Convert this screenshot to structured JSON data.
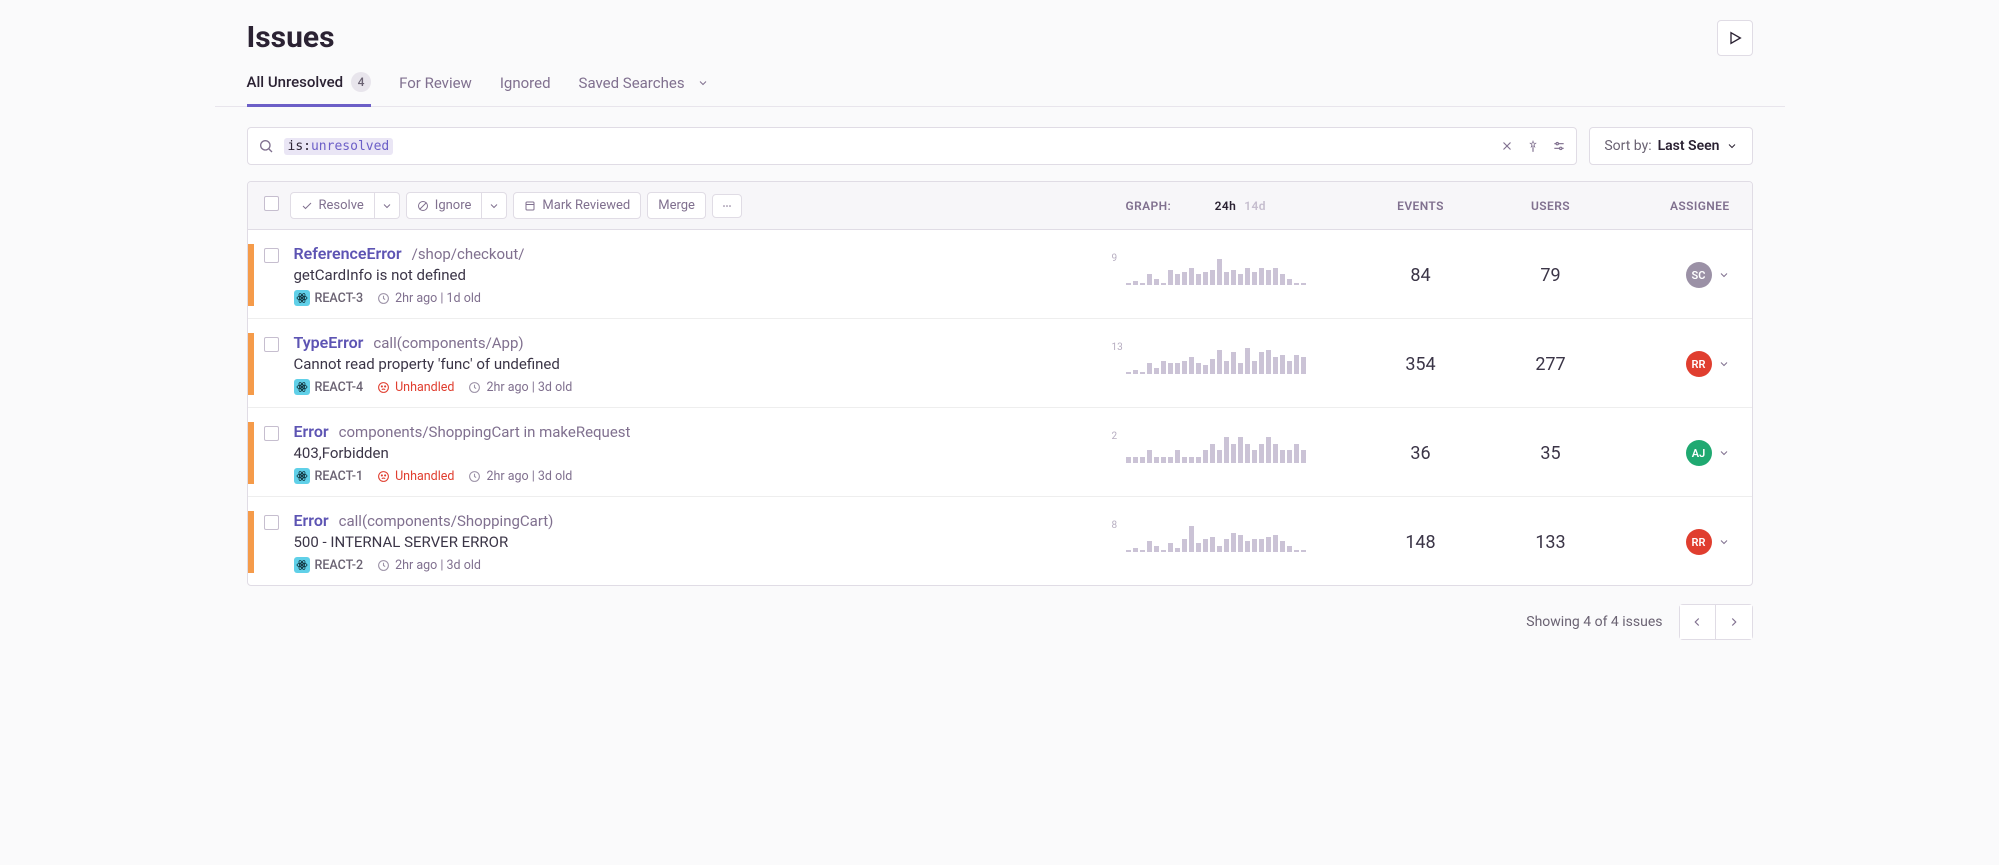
{
  "page_title": "Issues",
  "tabs": {
    "unresolved_label": "All Unresolved",
    "unresolved_count": "4",
    "review_label": "For Review",
    "ignored_label": "Ignored",
    "saved_searches_label": "Saved Searches"
  },
  "search": {
    "tag_key": "is:",
    "tag_value": "unresolved"
  },
  "sort": {
    "label": "Sort by:",
    "value": "Last Seen"
  },
  "toolbar": {
    "resolve": "Resolve",
    "ignore": "Ignore",
    "mark_reviewed": "Mark Reviewed",
    "merge": "Merge"
  },
  "columns": {
    "graph": "GRAPH:",
    "range_24h": "24h",
    "range_14d": "14d",
    "events": "EVENTS",
    "users": "USERS",
    "assignee": "ASSIGNEE"
  },
  "issues": [
    {
      "title": "ReferenceError",
      "location": "/shop/checkout/",
      "message": "getCardInfo is not defined",
      "project": "REACT-3",
      "unhandled": false,
      "time": "2hr ago",
      "age": "1d old",
      "peak": "9",
      "spark": [
        1,
        2,
        1,
        5,
        3,
        1,
        7,
        5,
        6,
        8,
        5,
        6,
        7,
        12,
        6,
        7,
        5,
        8,
        6,
        8,
        7,
        8,
        5,
        3,
        1,
        1
      ],
      "events": "84",
      "users": "79",
      "assignee_initials": "SC",
      "assignee_color": "#9b91a6"
    },
    {
      "title": "TypeError",
      "location": "call(components/App)",
      "message": "Cannot read property 'func' of undefined",
      "project": "REACT-4",
      "unhandled": true,
      "time": "2hr ago",
      "age": "3d old",
      "peak": "13",
      "spark": [
        1,
        2,
        1,
        5,
        3,
        6,
        5,
        5,
        6,
        8,
        5,
        4,
        7,
        11,
        6,
        10,
        5,
        12,
        6,
        10,
        11,
        8,
        9,
        6,
        9,
        8
      ],
      "events": "354",
      "users": "277",
      "assignee_initials": "RR",
      "assignee_color": "#e03e2f"
    },
    {
      "title": "Error",
      "location": "components/ShoppingCart in makeRequest",
      "message": "403,Forbidden",
      "project": "REACT-1",
      "unhandled": true,
      "time": "2hr ago",
      "age": "3d old",
      "peak": "2",
      "spark": [
        1,
        1,
        1,
        2,
        1,
        1,
        1,
        2,
        1,
        1,
        1,
        2,
        3,
        2,
        4,
        3,
        4,
        3,
        2,
        3,
        4,
        3,
        2,
        2,
        3,
        2
      ],
      "events": "36",
      "users": "35",
      "assignee_initials": "AJ",
      "assignee_color": "#1fa971"
    },
    {
      "title": "Error",
      "location": "call(components/ShoppingCart)",
      "message": "500 - INTERNAL SERVER ERROR",
      "project": "REACT-2",
      "unhandled": false,
      "time": "2hr ago",
      "age": "3d old",
      "peak": "8",
      "spark": [
        1,
        2,
        1,
        5,
        3,
        1,
        4,
        2,
        6,
        12,
        4,
        6,
        7,
        3,
        6,
        9,
        8,
        5,
        6,
        6,
        7,
        8,
        5,
        3,
        1,
        1
      ],
      "events": "148",
      "users": "133",
      "assignee_initials": "RR",
      "assignee_color": "#e03e2f"
    }
  ],
  "unhandled_label": "Unhandled",
  "footer": {
    "showing": "Showing 4 of 4 issues"
  }
}
